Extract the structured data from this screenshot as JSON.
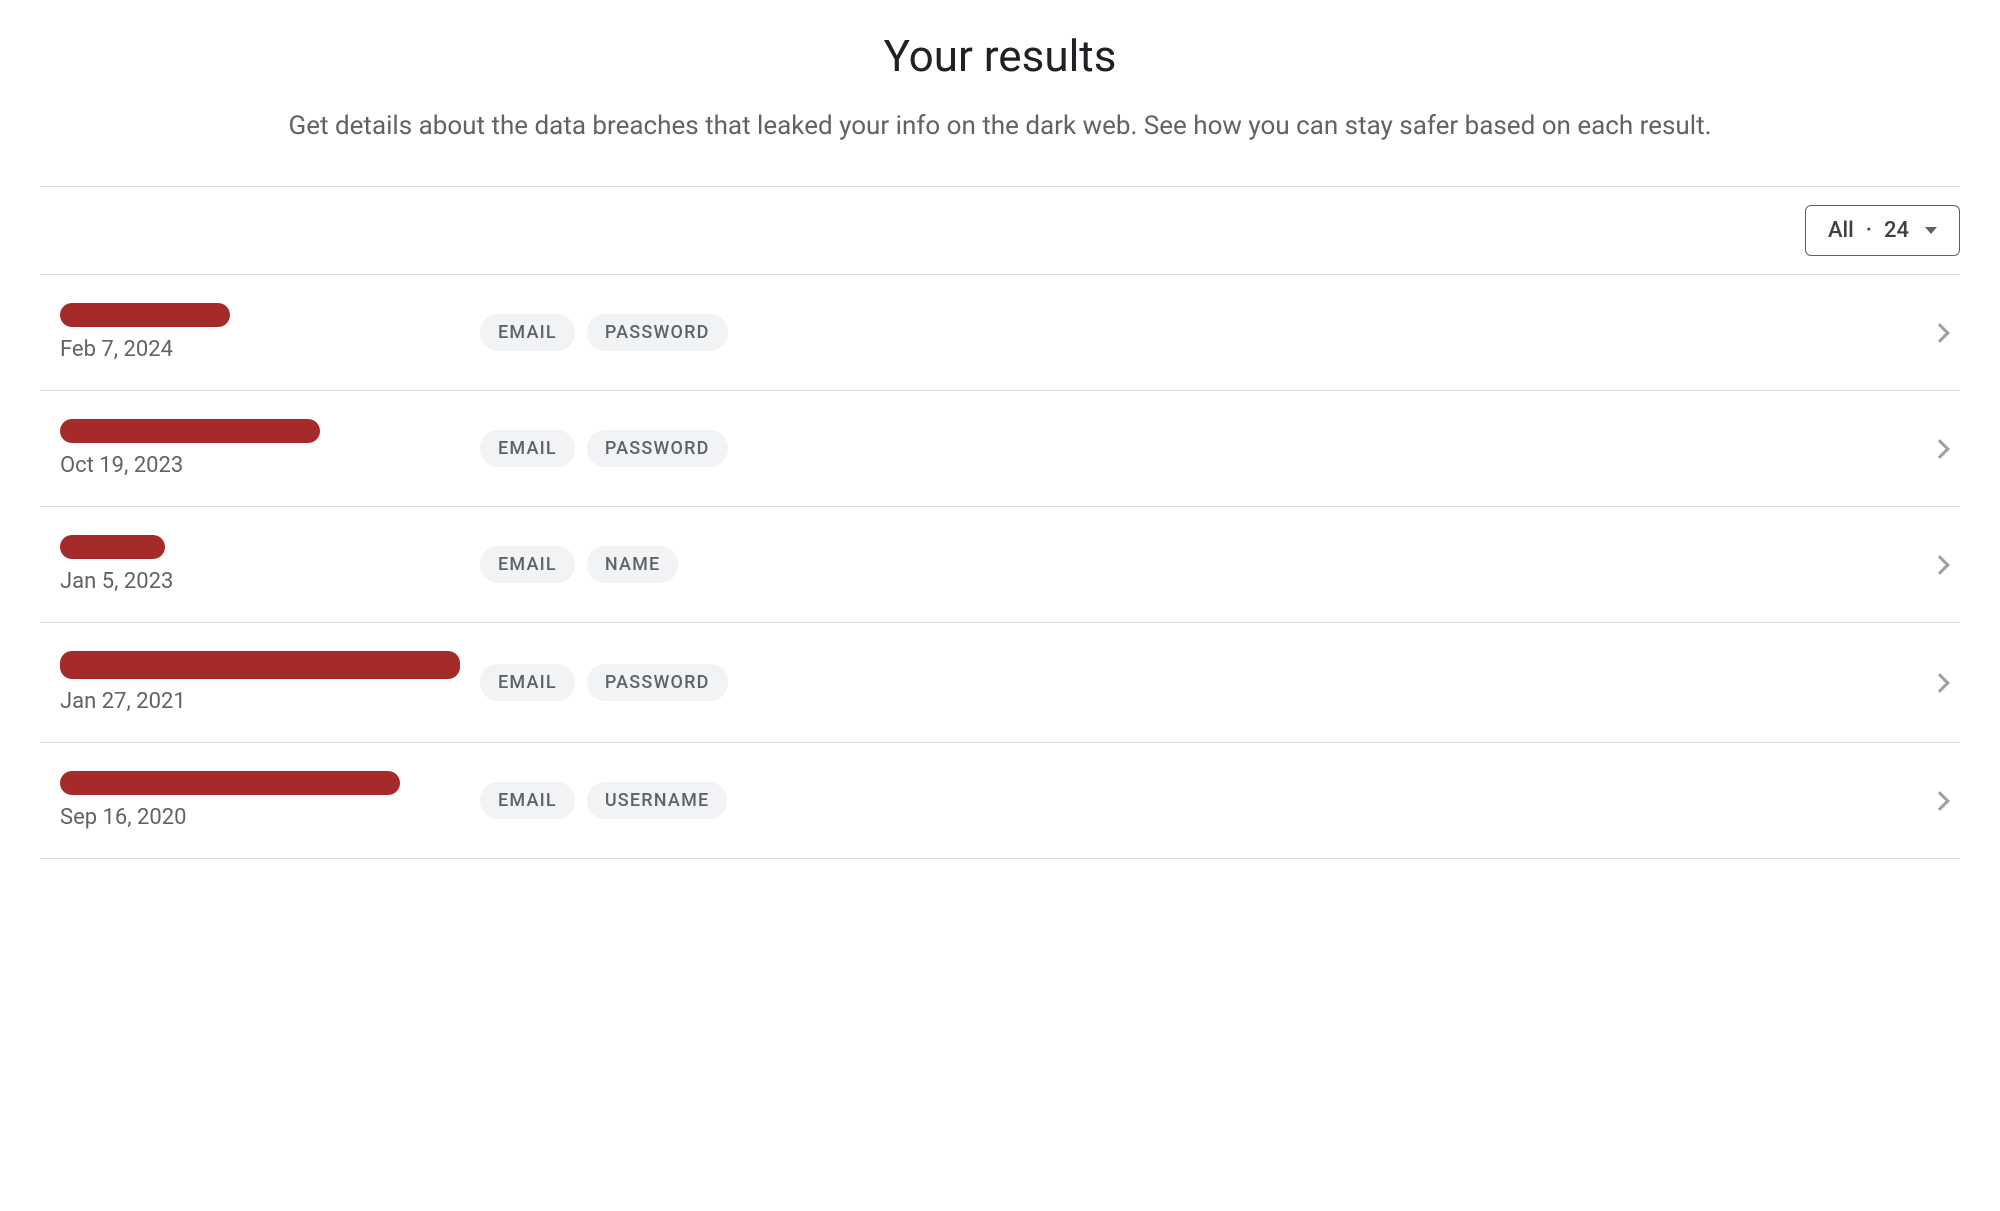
{
  "header": {
    "title": "Your results",
    "subtitle": "Get details about the data breaches that leaked your info on the dark web. See how you can stay safer based on each result."
  },
  "filter": {
    "label_prefix": "All",
    "separator": "·",
    "count": "24"
  },
  "results": [
    {
      "name_redacted": true,
      "redact_class": "redact-1",
      "date": "Feb 7, 2024",
      "tags": [
        "EMAIL",
        "PASSWORD"
      ]
    },
    {
      "name_redacted": true,
      "redact_class": "redact-2",
      "date": "Oct 19, 2023",
      "tags": [
        "EMAIL",
        "PASSWORD"
      ]
    },
    {
      "name_redacted": true,
      "redact_class": "redact-3",
      "date": "Jan 5, 2023",
      "tags": [
        "EMAIL",
        "NAME"
      ]
    },
    {
      "name_redacted": true,
      "redact_class": "redact-4",
      "date": "Jan 27, 2021",
      "tags": [
        "EMAIL",
        "PASSWORD"
      ]
    },
    {
      "name_redacted": true,
      "redact_class": "redact-5",
      "date": "Sep 16, 2020",
      "tags": [
        "EMAIL",
        "USERNAME"
      ]
    }
  ]
}
